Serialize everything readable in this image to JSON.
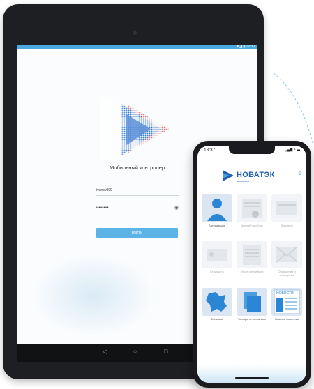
{
  "tablet": {
    "status_icons": "▼◢ ▮ 12:30",
    "app_title": "Мобильный контролер",
    "username_value": "ivanov999",
    "password_value": "••••••••••",
    "login_button": "ВОЙТИ",
    "nav": {
      "back": "◁",
      "home": "○",
      "recents": "□"
    }
  },
  "phone": {
    "time": "13:37",
    "status_icons": "▂▄▆ ◔ ▬",
    "brand": "НОВАТЭК",
    "brand_sub": "ЧЕЛЯБИНСК",
    "tiles": [
      {
        "label": "Авторизация",
        "icon": "person-icon",
        "active": true
      },
      {
        "label": "Данный по сбору",
        "icon": "document-icon",
        "active": false
      },
      {
        "label": "Действие",
        "icon": "calendar-icon",
        "active": false
      },
      {
        "label": "Стоимость",
        "icon": "card-icon",
        "active": false
      },
      {
        "label": "Отчёт о платёжах",
        "icon": "report-icon",
        "active": false
      },
      {
        "label": "Обращения и сообщения",
        "icon": "envelope-icon",
        "active": false
      },
      {
        "label": "Филиалы",
        "icon": "map-icon",
        "active": true
      },
      {
        "label": "Тарифы и нормативы",
        "icon": "tariff-icon",
        "active": true
      },
      {
        "label": "Новости компании",
        "icon": "news-icon",
        "active": true
      }
    ],
    "news_tile_label": "НОВОСТИ"
  }
}
